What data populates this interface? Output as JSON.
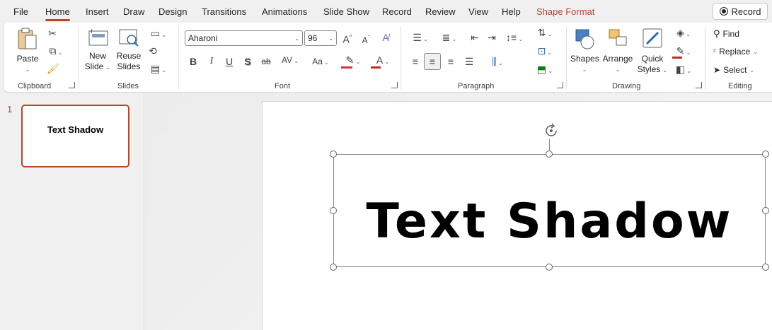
{
  "tabs": {
    "file": "File",
    "home": "Home",
    "insert": "Insert",
    "draw": "Draw",
    "design": "Design",
    "transitions": "Transitions",
    "animations": "Animations",
    "slide_show": "Slide Show",
    "record": "Record",
    "review": "Review",
    "view": "View",
    "help": "Help",
    "shape_format": "Shape Format"
  },
  "record_button": "Record",
  "clipboard": {
    "paste": "Paste",
    "label": "Clipboard"
  },
  "slides": {
    "new_slide_1": "New",
    "new_slide_2": "Slide",
    "reuse_1": "Reuse",
    "reuse_2": "Slides",
    "label": "Slides"
  },
  "font": {
    "name": "Aharoni",
    "size": "96",
    "label": "Font"
  },
  "paragraph": {
    "label": "Paragraph"
  },
  "drawing": {
    "shapes": "Shapes",
    "arrange": "Arrange",
    "quick_1": "Quick",
    "quick_2": "Styles",
    "label": "Drawing"
  },
  "editing": {
    "find": "Find",
    "replace": "Replace",
    "select": "Select",
    "label": "Editing"
  },
  "thumbnails": [
    {
      "number": "1",
      "title": "Text Shadow"
    }
  ],
  "slide": {
    "text": "Text Shadow"
  },
  "colors": {
    "accent": "#b7472a",
    "font_highlight": "#d13438",
    "font_color": "#c42b1c"
  }
}
